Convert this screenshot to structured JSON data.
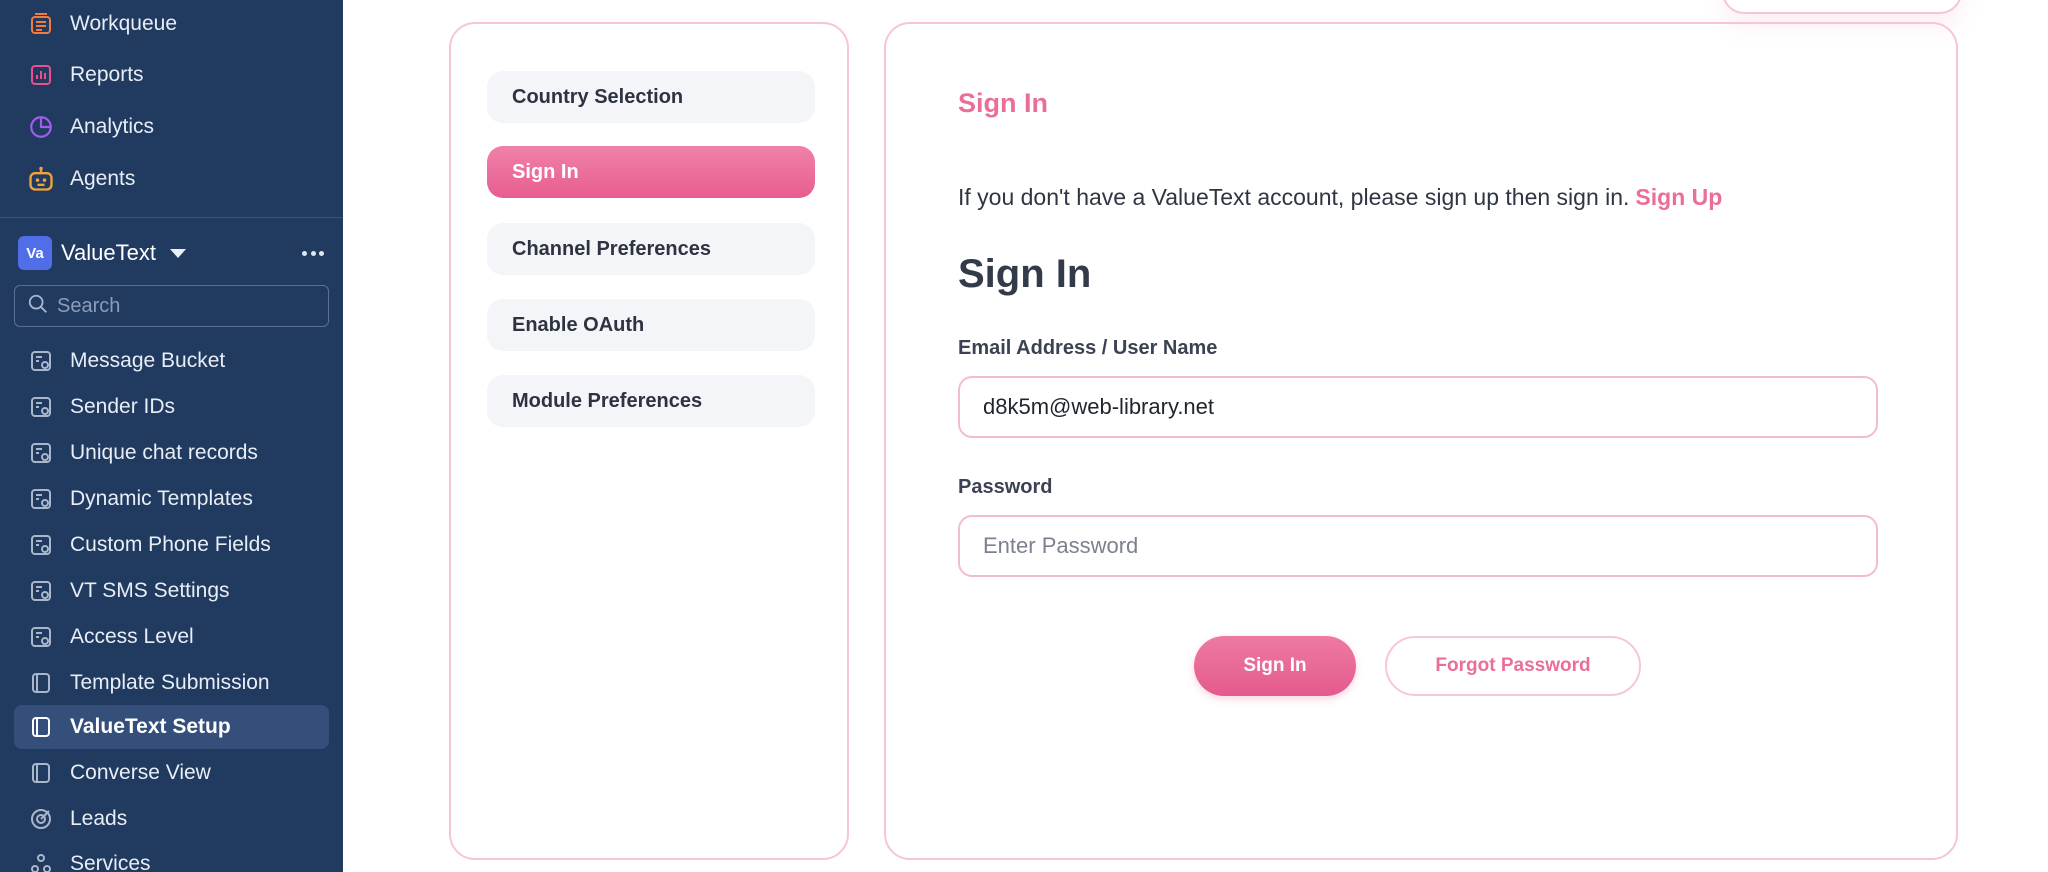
{
  "sidebar": {
    "top_items": [
      {
        "label": "Workqueue",
        "icon": "workqueue-icon",
        "color": "#f07b3f"
      },
      {
        "label": "Reports",
        "icon": "reports-icon",
        "color": "#ec4f8c"
      },
      {
        "label": "Analytics",
        "icon": "analytics-icon",
        "color": "#a45cf0"
      },
      {
        "label": "Agents",
        "icon": "agents-icon",
        "color": "#f2a33a"
      }
    ],
    "team": {
      "avatar": "Va",
      "name": "ValueText"
    },
    "search": {
      "placeholder": "Search"
    },
    "items": [
      {
        "label": "Message Bucket",
        "icon": "module-icon"
      },
      {
        "label": "Sender IDs",
        "icon": "module-icon"
      },
      {
        "label": "Unique chat records",
        "icon": "module-icon"
      },
      {
        "label": "Dynamic Templates",
        "icon": "module-icon"
      },
      {
        "label": "Custom Phone Fields",
        "icon": "module-icon"
      },
      {
        "label": "VT SMS Settings",
        "icon": "module-icon"
      },
      {
        "label": "Access Level",
        "icon": "module-icon"
      },
      {
        "label": "Template Submission",
        "icon": "page-icon"
      },
      {
        "label": "ValueText Setup",
        "icon": "page-icon",
        "active": true
      },
      {
        "label": "Converse View",
        "icon": "page-icon"
      },
      {
        "label": "Leads",
        "icon": "leads-icon"
      },
      {
        "label": "Services",
        "icon": "services-icon"
      }
    ]
  },
  "steps": [
    {
      "label": "Country Selection"
    },
    {
      "label": "Sign In",
      "active": true
    },
    {
      "label": "Channel Preferences"
    },
    {
      "label": "Enable OAuth"
    },
    {
      "label": "Module Preferences"
    }
  ],
  "form": {
    "title": "Sign In",
    "intro_text": "If you don't have a ValueText account, please sign up then sign in.",
    "signup_link": "Sign Up",
    "heading": "Sign In",
    "email_label": "Email Address / User Name",
    "email_value": "d8k5m@web-library.net",
    "password_label": "Password",
    "password_placeholder": "Enter Password",
    "signin_button": "Sign In",
    "forgot_button": "Forgot Password"
  },
  "colors": {
    "accent": "#eb6e99",
    "sidebar_bg": "#213a60"
  }
}
